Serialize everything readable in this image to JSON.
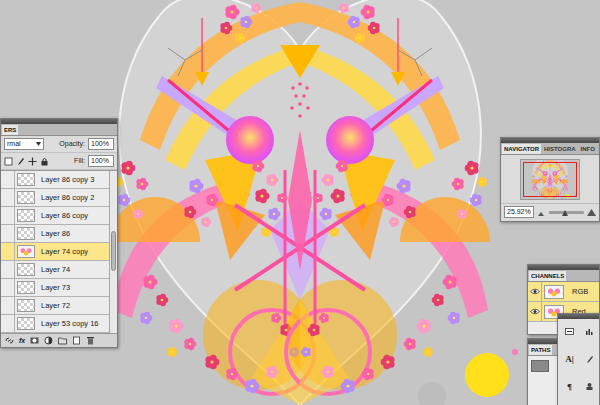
{
  "layers_panel": {
    "title": "ERS",
    "blend_mode": "rmal",
    "opacity_label": "Opacity:",
    "opacity": "100%",
    "fill_label": "Fill:",
    "fill": "100%",
    "effects_button": "fx",
    "layers": [
      {
        "name": "Layer 86 copy 3",
        "selected": false,
        "kind": "transparent"
      },
      {
        "name": "Layer 86 copy 2",
        "selected": false,
        "kind": "transparent"
      },
      {
        "name": "Layer 86 copy",
        "selected": false,
        "kind": "transparent"
      },
      {
        "name": "Layer 86",
        "selected": false,
        "kind": "transparent"
      },
      {
        "name": "Layer 74 copy",
        "selected": true,
        "kind": "art"
      },
      {
        "name": "Layer 74",
        "selected": false,
        "kind": "transparent"
      },
      {
        "name": "Layer 73",
        "selected": false,
        "kind": "transparent"
      },
      {
        "name": "Layer 72",
        "selected": false,
        "kind": "transparent"
      },
      {
        "name": "Layer 53 copy 16",
        "selected": false,
        "kind": "transparent"
      }
    ]
  },
  "navigator_panel": {
    "tabs": [
      {
        "label": "NAVIGATOR",
        "selected": true
      },
      {
        "label": "HISTOGRA",
        "selected": false
      },
      {
        "label": "INFO",
        "selected": false
      }
    ],
    "zoom": "25.92%",
    "zoom_level": 0.45
  },
  "channels_panel": {
    "title": "CHANNELS",
    "channels": [
      {
        "name": "RGB",
        "visible": true,
        "selected": true
      },
      {
        "name": "Red",
        "visible": true,
        "selected": true
      }
    ]
  },
  "paths_panel": {
    "title": "PATHS"
  },
  "tools_panel": {
    "tools": [
      {
        "kind": "icon",
        "label": ""
      },
      {
        "kind": "icon",
        "label": ""
      },
      {
        "kind": "text",
        "label": "A|"
      },
      {
        "kind": "icon",
        "label": ""
      },
      {
        "kind": "text",
        "label": "¶"
      },
      {
        "kind": "icon",
        "label": ""
      }
    ]
  }
}
